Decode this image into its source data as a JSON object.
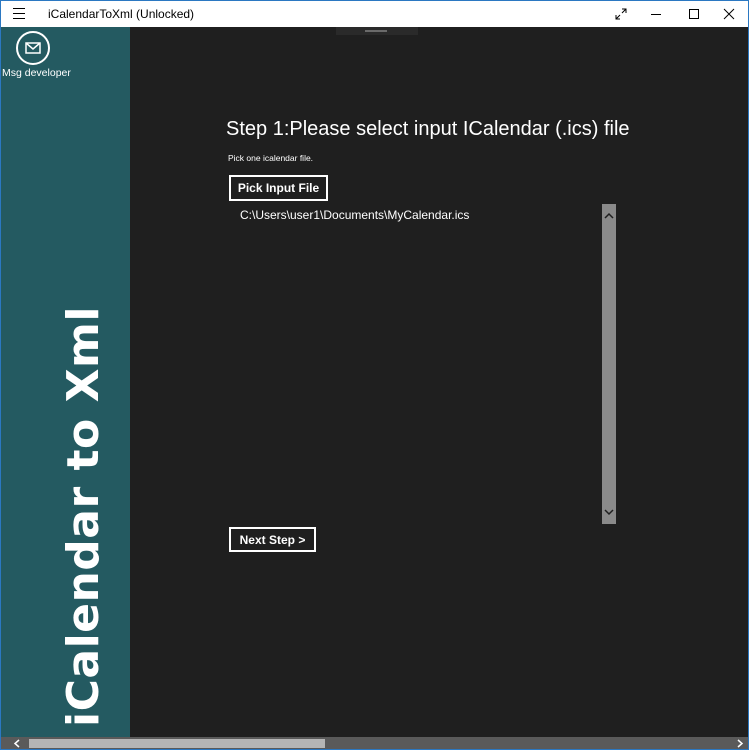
{
  "window": {
    "title": "iCalendarToXml (Unlocked)"
  },
  "titlebar": {
    "menu_icon": "hamburger-icon",
    "fullscreen_icon": "expand-icon",
    "minimize_glyph": "—",
    "maximize_glyph": "☐",
    "close_glyph": "✕"
  },
  "sidebar": {
    "msg_icon": "mail-icon",
    "msg_label": "Msg developer",
    "app_title": "iCalendar to Xml",
    "background": "#245a61"
  },
  "main": {
    "step_title": "Step 1:Please select input ICalendar (.ics) file",
    "step_subtitle": "Pick one icalendar file.",
    "pick_button": "Pick Input File",
    "files": [
      "C:\\Users\\user1\\Documents\\MyCalendar.ics"
    ],
    "next_button": "Next Step >"
  },
  "colors": {
    "content_bg": "#1f1f1f",
    "text": "#ffffff",
    "window_border": "#2b78c2"
  }
}
